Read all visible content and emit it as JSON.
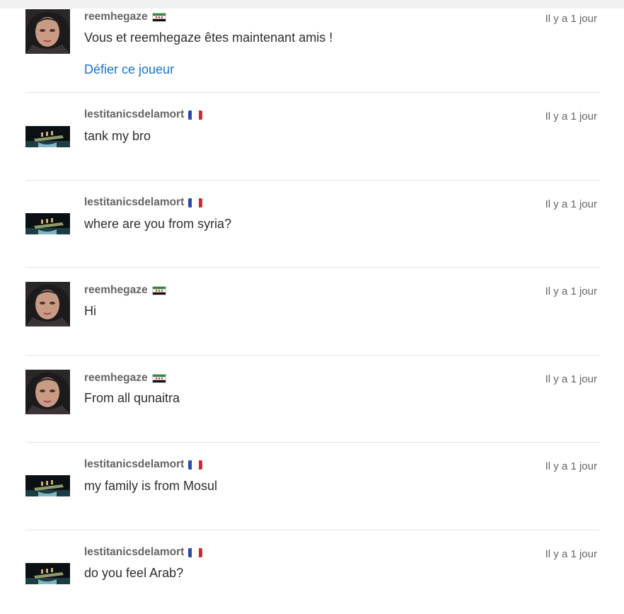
{
  "feed": {
    "items": [
      {
        "username": "reemhegaze",
        "flag": "syria-flag",
        "time": "Il y a 1 jour",
        "message": "Vous et reemhegaze êtes maintenant amis !",
        "action": "Défier ce joueur",
        "avatar": "woman-avatar"
      },
      {
        "username": "lestitanicsdelamort",
        "flag": "france-flag",
        "time": "Il y a 1 jour",
        "message": "tank my bro",
        "avatar": "titanic-avatar"
      },
      {
        "username": "lestitanicsdelamort",
        "flag": "france-flag",
        "time": "Il y a 1 jour",
        "message": "where are you from syria?",
        "avatar": "titanic-avatar"
      },
      {
        "username": "reemhegaze",
        "flag": "syria-flag",
        "time": "Il y a 1 jour",
        "message": "Hi",
        "avatar": "woman-avatar"
      },
      {
        "username": "reemhegaze",
        "flag": "syria-flag",
        "time": "Il y a 1 jour",
        "message": "From all qunaitra",
        "avatar": "woman-avatar"
      },
      {
        "username": "lestitanicsdelamort",
        "flag": "france-flag",
        "time": "Il y a 1 jour",
        "message": "my family is from Mosul",
        "avatar": "titanic-avatar"
      },
      {
        "username": "lestitanicsdelamort",
        "flag": "france-flag",
        "time": "Il y a 1 jour",
        "message": "do you feel Arab?",
        "avatar": "titanic-avatar"
      }
    ]
  },
  "colors": {
    "link": "#1a73c4",
    "username": "#666463",
    "text": "#312e2b",
    "divider": "#e3e3e3"
  }
}
